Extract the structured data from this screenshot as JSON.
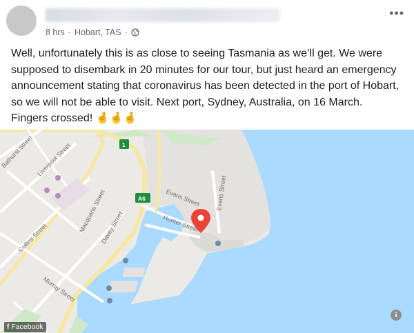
{
  "post": {
    "author_name": "",
    "time": "8 hrs",
    "separator": "·",
    "location": "Hobart, TAS",
    "separator2": "·",
    "privacy_icon": "globe-icon",
    "more_icon": "ellipsis-icon",
    "more_label": "•••",
    "text": "Well, unfortunately this is as close to seeing Tasmania as we’ll get. We were supposed to disembark in 20 minutes for our tour, but just heard an emergency announcement stating that coronavirus has been detected in the port of Hobart, so we will not be able to visit. Next port, Sydney, Australia, on 16 March. Fingers crossed!",
    "emoji": "🤞🤞🤞"
  },
  "map": {
    "streets": {
      "bathurst": "Bathurst Street",
      "liverpool": "Liverpool Street",
      "collins": "Collins Street",
      "murray": "Murray Street",
      "macquarie": "Macquarie Street",
      "davey": "Davey Street",
      "evans": "Evans Street",
      "evans2": "Evans Street",
      "hunter": "Hunter Street"
    },
    "shields": {
      "route1": "1",
      "a6": "A6"
    },
    "pin_icon": "map-pin-icon",
    "info_icon_label": "i"
  },
  "watermark": {
    "icon": "facebook-icon",
    "label": "Facebook"
  },
  "colors": {
    "water": "#aadaff",
    "land": "#eceae6",
    "pin": "#ea4335",
    "route": "#1e8e3e"
  }
}
